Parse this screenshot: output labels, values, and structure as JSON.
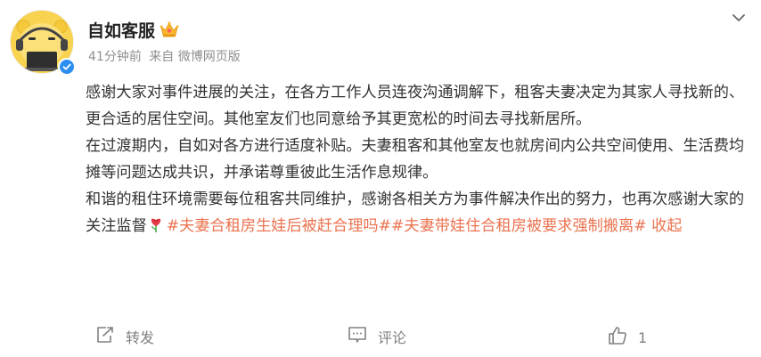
{
  "post": {
    "author_name": "自如客服",
    "time": "41分钟前",
    "source": "来自 微博网页版",
    "paragraphs": [
      "感谢大家对事件进展的关注，在各方工作人员连夜沟通调解下，租客夫妻决定为其家人寻找新的、更合适的居住空间。其他室友们也同意给予其更宽松的时间去寻找新居所。",
      "在过渡期内，自如对各方进行适度补贴。夫妻租客和其他室友也就房间内公共空间使用、生活费均摊等问题达成共识，并承诺尊重彼此生活作息规律。"
    ],
    "last_paragraph_text": "和谐的租住环境需要每位租客共同维护，感谢各相关方为事件解决作出的努力，也再次感谢大家的关注监督",
    "hashtag_1": "#夫妻合租房生娃后被赶合理吗#",
    "hashtag_2": "#夫妻带娃住合租房被要求强制搬离#",
    "collapse_label": "收起"
  },
  "actions": {
    "repost_label": "转发",
    "comment_label": "评论",
    "like_count": "1"
  },
  "icons": {
    "crown": "crown-icon",
    "verified": "verified-badge-icon",
    "menu": "chevron-down-icon",
    "flower": "rose-icon",
    "repost": "repost-icon",
    "comment": "comment-icon",
    "like": "thumbs-up-icon"
  },
  "colors": {
    "link": "#eb7350",
    "meta": "#8f8f8f",
    "verified": "#2d8ef1",
    "avatar_bg": "#f8d34f"
  }
}
